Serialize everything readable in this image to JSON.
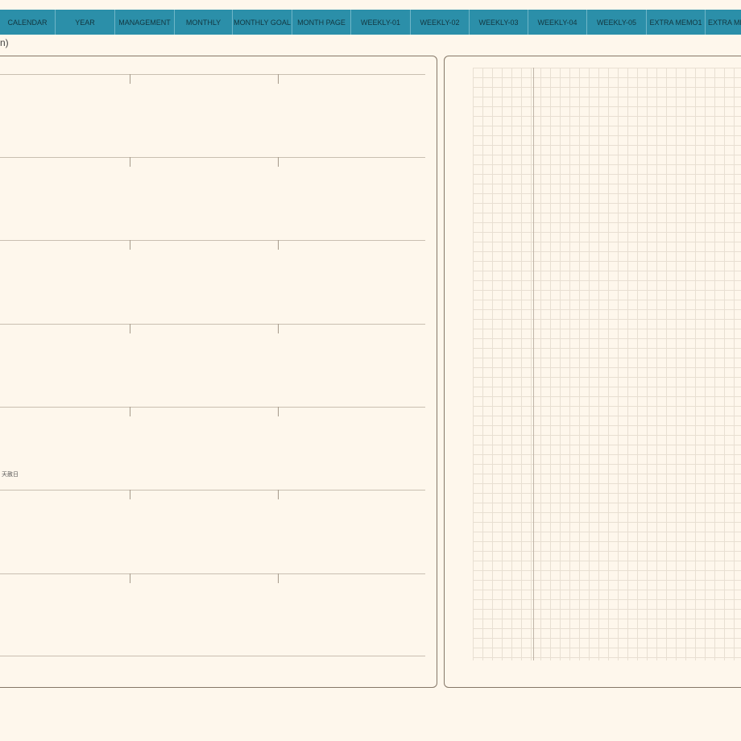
{
  "tabs": [
    {
      "label": "CALENDAR"
    },
    {
      "label": "YEAR"
    },
    {
      "label": "MANAGEMENT"
    },
    {
      "label": "MONTHLY"
    },
    {
      "label": "MONTHLY GOAL"
    },
    {
      "label": "MONTH PAGE"
    },
    {
      "label": "WEEKLY-01"
    },
    {
      "label": "WEEKLY-02"
    },
    {
      "label": "WEEKLY-03"
    },
    {
      "label": "WEEKLY-04"
    },
    {
      "label": "WEEKLY-05"
    },
    {
      "label": "EXTRA MEMO1"
    },
    {
      "label": "EXTRA ME"
    }
  ],
  "header": {
    "date_fragment": "n)"
  },
  "left_panel": {
    "note": "天赦日"
  },
  "colors": {
    "tab_bar": "#2b8fa9",
    "background": "#fef7ec",
    "panel_border": "#857767"
  }
}
